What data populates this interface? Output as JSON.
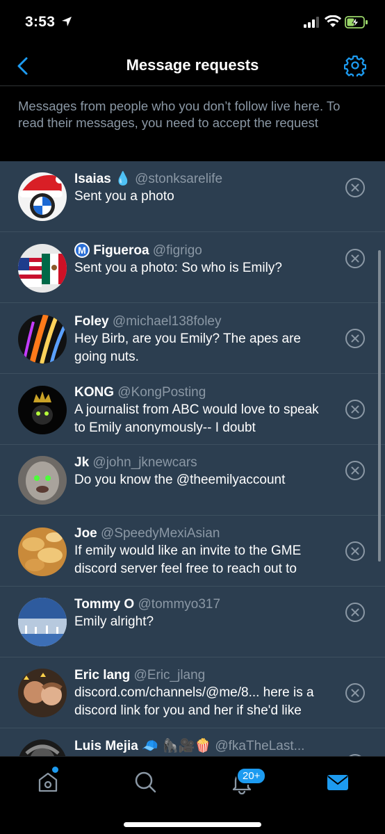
{
  "status": {
    "time": "3:53"
  },
  "nav": {
    "title": "Message requests"
  },
  "info": {
    "text": "Messages from people who you don’t follow live here. To read their messages, you need to accept the request"
  },
  "requests": [
    {
      "name": "Isaias",
      "emoji": "💧",
      "handle": "@stonksarelife",
      "message": "Sent you a photo"
    },
    {
      "prefix": "M",
      "name": "Figueroa",
      "handle": "@figrigo",
      "message": "Sent you a photo: So who is Emily?"
    },
    {
      "name": "Foley",
      "handle": "@michael138foley",
      "message": "Hey Birb, are you Emily? The apes are going nuts."
    },
    {
      "name": "KONG",
      "handle": "@KongPosting",
      "message": "A journalist from ABC would love to speak to Emily anonymously-- I doubt"
    },
    {
      "name": "Jk",
      "handle": "@john_jknewcars",
      "message": "Do you know the @theemilyaccount"
    },
    {
      "name": "Joe",
      "handle": "@SpeedyMexiAsian",
      "message": "If emily would like an invite to the GME discord server feel free to reach out to"
    },
    {
      "name": "Tommy O",
      "handle": "@tommyo317",
      "message": "Emily alright?"
    },
    {
      "name": "Eric lang",
      "handle": "@Eric_jlang",
      "message": "discord.com/channels/@me/8... here is a discord link for you and her if she'd like"
    },
    {
      "name": "Luis Mejia",
      "emoji": "🧢 🦍🎥🍿",
      "handle": "@fkaTheLast...",
      "message": ""
    }
  ],
  "tabbar": {
    "notifications_badge": "20+"
  },
  "colors": {
    "accent": "#1d9bf0",
    "list_bg": "#2c3e50",
    "secondary_text": "#8b98a5"
  },
  "icons": [
    "back-chevron-icon",
    "gear-icon",
    "close-circle-icon",
    "home-icon",
    "search-icon",
    "bell-icon",
    "mail-icon"
  ]
}
